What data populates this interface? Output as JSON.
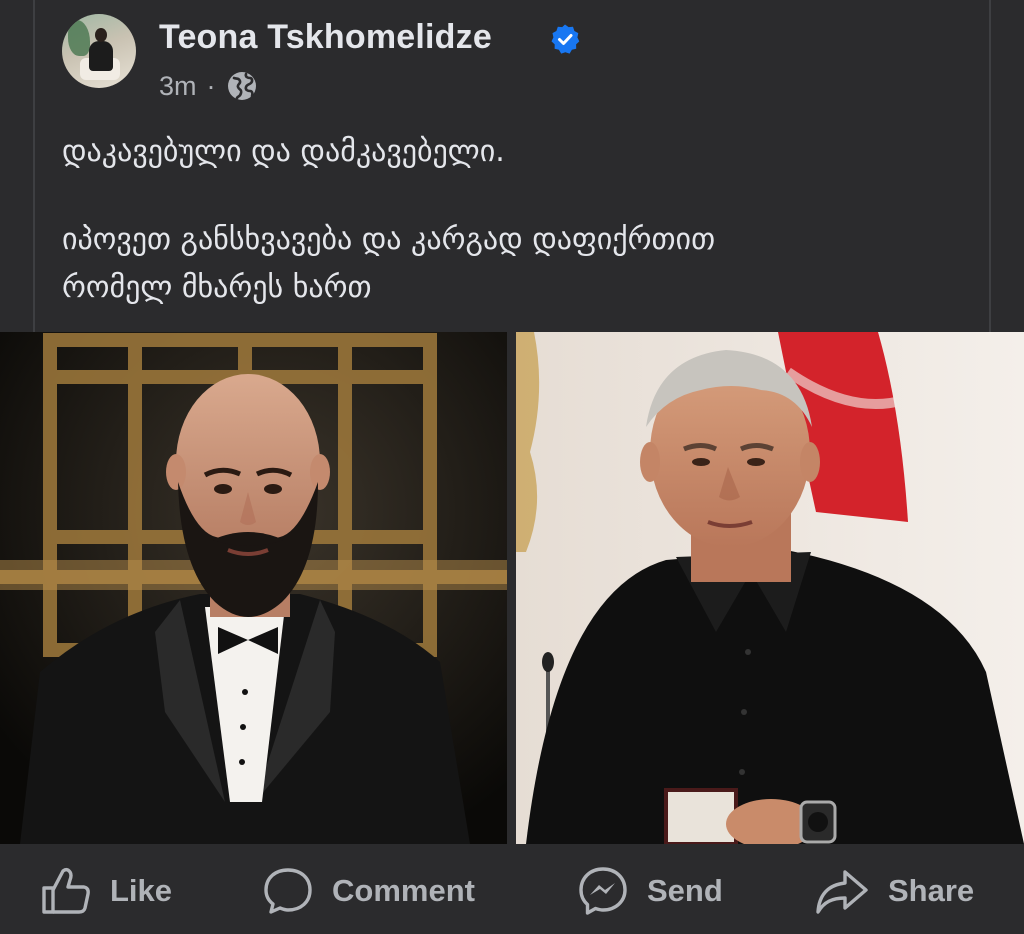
{
  "post": {
    "author_name": "Teona Tskhomelidze",
    "timestamp": "3m",
    "separator": "·",
    "audience_icon": "globe-icon",
    "verified_icon": "verified-badge-icon",
    "text_line_1": "დაკავებული და დამკავებელი.",
    "text_line_2": "იპოვეთ განსხვავება და კარგად დაფიქრთით",
    "text_line_3": "რომელ მხარეს ხართ"
  },
  "images": {
    "left_icon": "photo-bearded-man-tuxedo",
    "right_icon": "photo-man-black-shirt-with-flag"
  },
  "actions": {
    "like_label": "Like",
    "comment_label": "Comment",
    "send_label": "Send",
    "share_label": "Share"
  },
  "colors": {
    "background": "#2b2b2d",
    "text_primary": "#e4e6eb",
    "text_secondary": "#b0b3b8",
    "verified_blue": "#1877f2"
  }
}
